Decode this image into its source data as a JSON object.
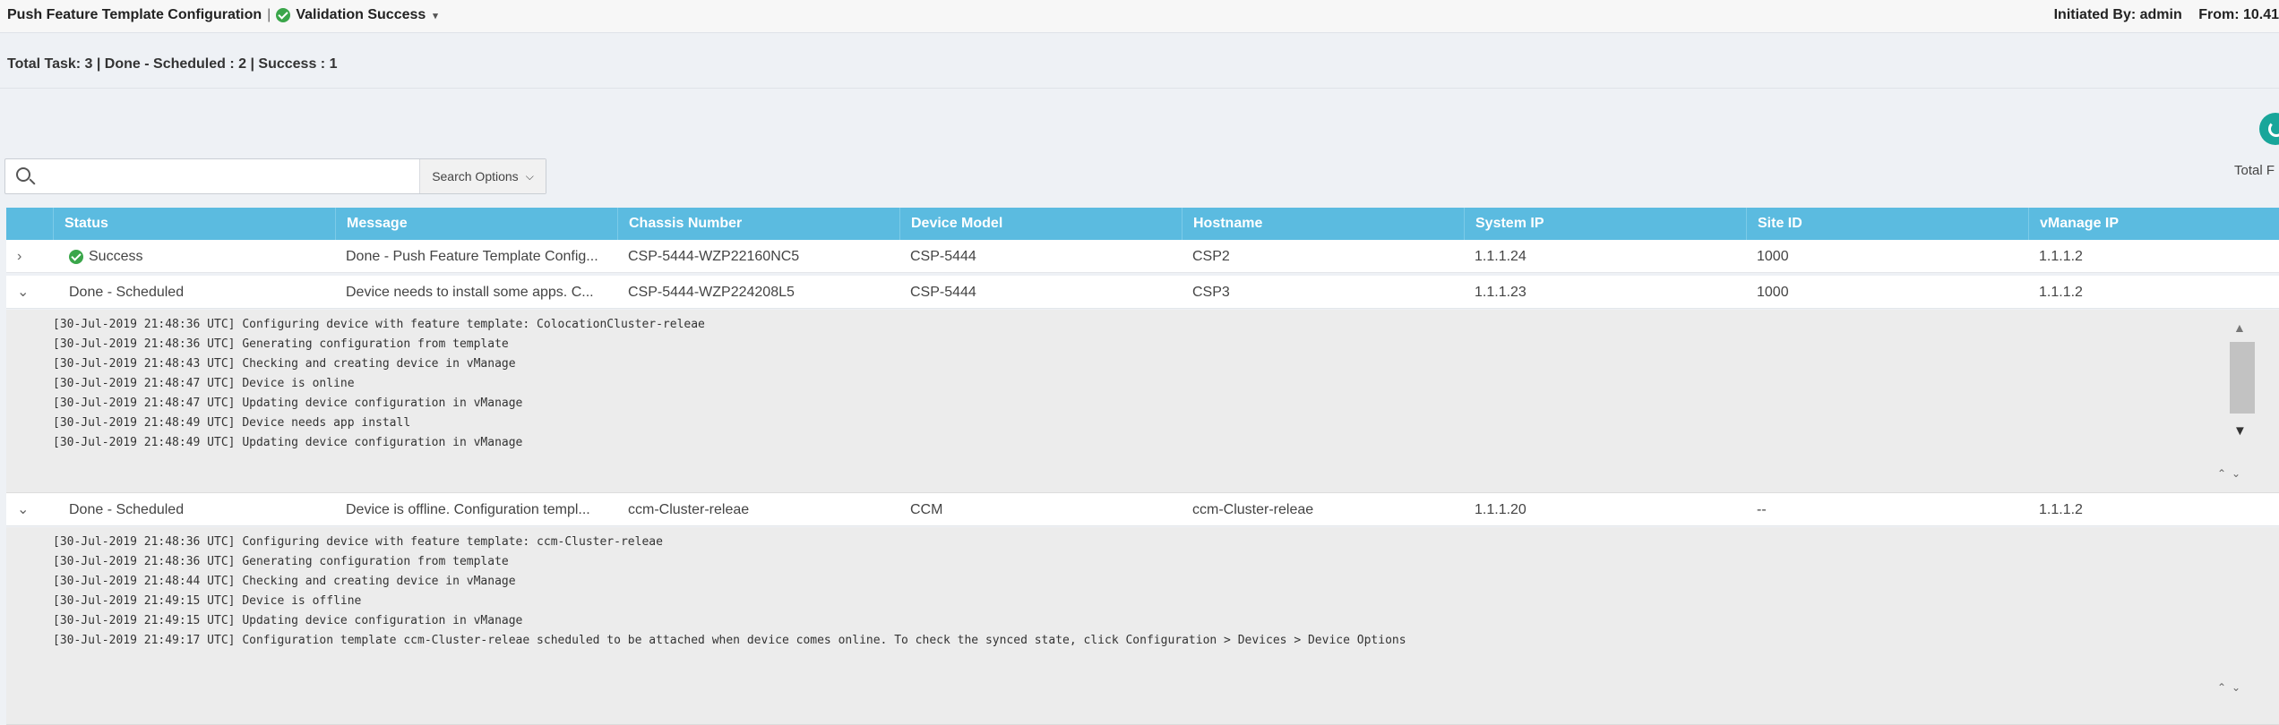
{
  "header": {
    "title": "Push Feature Template Configuration",
    "separator": "|",
    "status": "Validation Success",
    "initiated_by": "Initiated By: admin",
    "from": "From: 10.41"
  },
  "summary": "Total Task: 3 | Done - Scheduled : 2 | Success : 1",
  "refresh": {
    "label": "Total F"
  },
  "search": {
    "placeholder": "",
    "value": "",
    "options_label": "Search Options"
  },
  "table": {
    "columns": [
      "Status",
      "Message",
      "Chassis Number",
      "Device Model",
      "Hostname",
      "System IP",
      "Site ID",
      "vManage IP"
    ],
    "rows": [
      {
        "expanded": false,
        "toggle": "›",
        "status": "Success",
        "message": "Done - Push Feature Template Config...",
        "chassis": "CSP-5444-WZP22160NC5",
        "model": "CSP-5444",
        "hostname": "CSP2",
        "system_ip": "1.1.1.24",
        "site_id": "1000",
        "vmanage_ip": "1.1.1.2"
      },
      {
        "expanded": true,
        "toggle": "⌄",
        "status": "Done - Scheduled",
        "message": "Device needs to install some apps. C...",
        "chassis": "CSP-5444-WZP224208L5",
        "model": "CSP-5444",
        "hostname": "CSP3",
        "system_ip": "1.1.1.23",
        "site_id": "1000",
        "vmanage_ip": "1.1.1.2",
        "logs": [
          "[30-Jul-2019 21:48:36 UTC] Configuring device with feature template: ColocationCluster-releae",
          "[30-Jul-2019 21:48:36 UTC] Generating configuration from template",
          "[30-Jul-2019 21:48:43 UTC] Checking and creating device in vManage",
          "[30-Jul-2019 21:48:47 UTC] Device is online",
          "[30-Jul-2019 21:48:47 UTC] Updating device configuration in vManage",
          "[30-Jul-2019 21:48:49 UTC] Device needs app install",
          "[30-Jul-2019 21:48:49 UTC] Updating device configuration in vManage"
        ]
      },
      {
        "expanded": true,
        "toggle": "⌄",
        "status": "Done - Scheduled",
        "message": "Device is offline. Configuration templ...",
        "chassis": "ccm-Cluster-releae",
        "model": "CCM",
        "hostname": "ccm-Cluster-releae",
        "system_ip": "1.1.1.20",
        "site_id": "--",
        "vmanage_ip": "1.1.1.2",
        "logs": [
          "[30-Jul-2019 21:48:36 UTC] Configuring device with feature template: ccm-Cluster-releae",
          "[30-Jul-2019 21:48:36 UTC] Generating configuration from template",
          "[30-Jul-2019 21:48:44 UTC] Checking and creating device in vManage",
          "[30-Jul-2019 21:49:15 UTC] Device is offline",
          "[30-Jul-2019 21:49:15 UTC] Updating device configuration in vManage",
          "[30-Jul-2019 21:49:17 UTC] Configuration template ccm-Cluster-releae scheduled to be attached when device comes online. To check the synced state, click Configuration > Devices > Device Options"
        ]
      }
    ]
  },
  "icons": {
    "status_check": "check-circle-icon",
    "refresh": "refresh-icon",
    "search": "search-icon"
  },
  "colors": {
    "header_bg": "#5bbbe0",
    "success": "#3aa64a",
    "refresh": "#18a69a"
  }
}
